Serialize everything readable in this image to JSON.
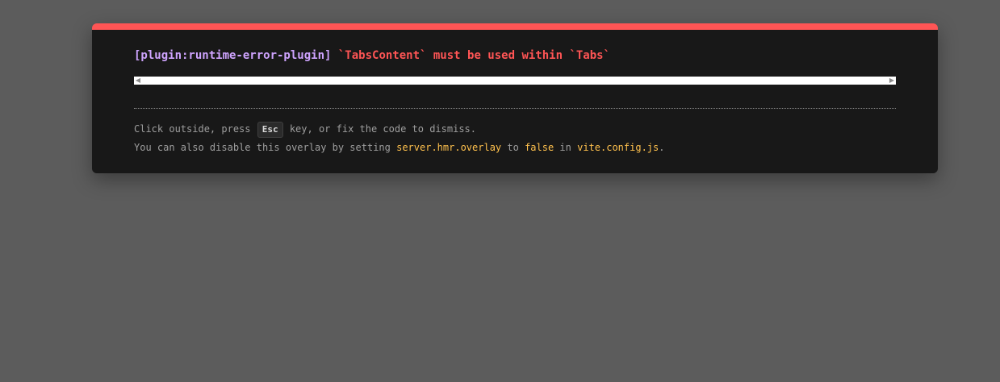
{
  "error": {
    "plugin": "[plugin:runtime-error-plugin]",
    "message": "`TabsContent` must be used within `Tabs`"
  },
  "tip": {
    "line1_before": "Click outside, press ",
    "esc_key": "Esc",
    "line1_after": " key, or fix the code to dismiss.",
    "line2_before": "You can also disable this overlay by setting ",
    "config_option": "server.hmr.overlay",
    "line2_to": " to ",
    "false_value": "false",
    "line2_in": " in ",
    "config_file": "vite.config.js",
    "line2_end": "."
  },
  "colors": {
    "accent": "#ff5555",
    "plugin": "#cfa4ff",
    "code": "#ffc14d",
    "panel": "#181818",
    "backdrop": "#5c5c5c"
  },
  "icons": {
    "scroll_left": "scroll-left-arrow-icon",
    "scroll_right": "scroll-right-arrow-icon"
  }
}
